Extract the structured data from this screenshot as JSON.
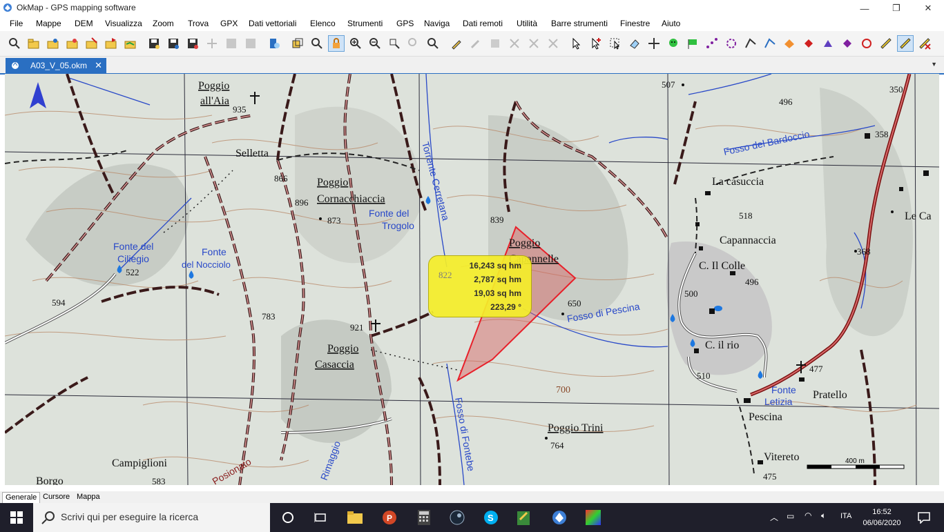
{
  "window": {
    "title": "OkMap - GPS mapping software",
    "minimize_glyph": "—",
    "restore_glyph": "❐",
    "close_glyph": "✕"
  },
  "menu": [
    "File",
    "Mappe",
    "DEM",
    "Visualizza",
    "Zoom",
    "Trova",
    "GPX",
    "Dati vettoriali",
    "Elenco",
    "Strumenti",
    "GPS",
    "Naviga",
    "Dati remoti",
    "Utilità",
    "Barre strumenti",
    "Finestre",
    "Aiuto"
  ],
  "document_tab": {
    "label": "A03_V_05.okm",
    "close_glyph": "✕"
  },
  "map": {
    "labels": [
      {
        "text": "Poggio"
      },
      {
        "text": "all'Aia"
      },
      {
        "text": "935"
      },
      {
        "text": "Selletta"
      },
      {
        "text": "866"
      },
      {
        "text": "896"
      },
      {
        "text": "Poggio"
      },
      {
        "text": "Cornacchiaccia"
      },
      {
        "text": "873"
      },
      {
        "text": "Fonte del"
      },
      {
        "text": "Trogolo"
      },
      {
        "text": "839"
      },
      {
        "text": "Poggio"
      },
      {
        "text": "Capannelle"
      },
      {
        "text": "650"
      },
      {
        "text": "Fosso di Pescina"
      },
      {
        "text": "Fonte del"
      },
      {
        "text": "Ciliegio"
      },
      {
        "text": "Fonte"
      },
      {
        "text": "del Nocciolo"
      },
      {
        "text": "522"
      },
      {
        "text": "594"
      },
      {
        "text": "783"
      },
      {
        "text": "921"
      },
      {
        "text": "Poggio"
      },
      {
        "text": "Casaccia"
      },
      {
        "text": "700"
      },
      {
        "text": "Poggio Trini"
      },
      {
        "text": "764"
      },
      {
        "text": "Campiglioni"
      },
      {
        "text": "583"
      },
      {
        "text": "Borgo"
      },
      {
        "text": "507"
      },
      {
        "text": "496"
      },
      {
        "text": "Fosso del Bardoccio"
      },
      {
        "text": "350"
      },
      {
        "text": "358"
      },
      {
        "text": "La casuccia"
      },
      {
        "text": "518"
      },
      {
        "text": "Capannaccia"
      },
      {
        "text": "C. Il Colle"
      },
      {
        "text": "496"
      },
      {
        "text": "500"
      },
      {
        "text": "368"
      },
      {
        "text": "Le Ca"
      },
      {
        "text": "C. il rio"
      },
      {
        "text": "510"
      },
      {
        "text": "477"
      },
      {
        "text": "Fonte"
      },
      {
        "text": "Letizia"
      },
      {
        "text": "Pratello"
      },
      {
        "text": "Pescina"
      },
      {
        "text": "Vitereto"
      },
      {
        "text": "475"
      },
      {
        "text": "Torrente Cerretana"
      },
      {
        "text": "Fosso di Fontebe"
      },
      {
        "text": "Rimaggio"
      },
      {
        "text": "Posionato"
      },
      {
        "text": "822"
      },
      {
        "text": "400 m"
      }
    ],
    "measure_popup": {
      "lines": [
        "16,243 sq hm",
        "2,787 sq hm",
        "19,03 sq hm",
        "223,29 °"
      ]
    },
    "scale_label": "400 m"
  },
  "bottom_tabs": [
    "Generale",
    "Cursore",
    "Mappa"
  ],
  "taskbar": {
    "search_placeholder": "Scrivi qui per eseguire la ricerca",
    "language": "ITA",
    "time": "16:52",
    "date": "06/06/2020"
  },
  "colors": {
    "accent_blue": "#2a6fc2",
    "trail_red": "#b02020",
    "contour": "#b97a5a",
    "water": "#2848c8",
    "popup_yellow": "#f5ee2a",
    "polygon_red": "#e8202a"
  }
}
